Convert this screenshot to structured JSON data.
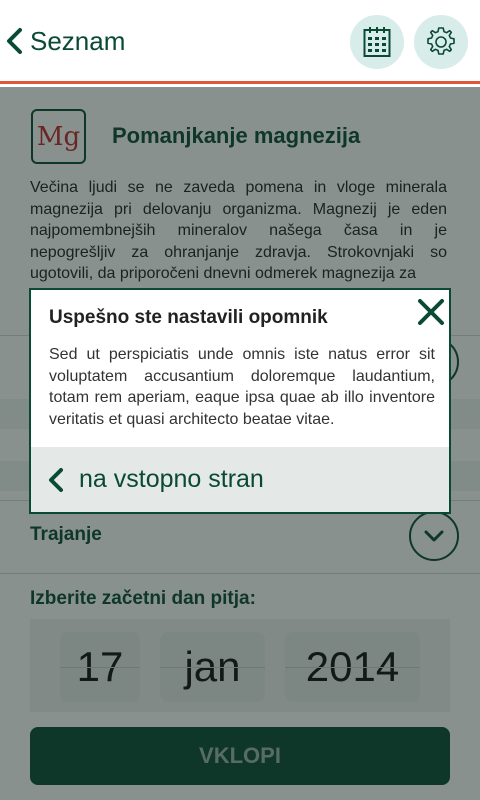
{
  "header": {
    "back_label": "Seznam",
    "calendar_icon": "calendar-icon",
    "settings_icon": "gear-icon"
  },
  "mineral": {
    "symbol": "Mg",
    "title": "Pomanjkanje magnezija",
    "intro": "Večina ljudi se ne zaveda pomena in vloge minerala magnezija pri delovanju organizma. Magnezij je eden najpomembnejših mineralov našega časa in je nepogrešljiv za ohranjanje zdravja. Strokovnjaki so ugotovili, da priporočeni dnevni odmerek magnezija za"
  },
  "duration": {
    "label": "Trajanje"
  },
  "start_date": {
    "label": "Izberite začetni dan pitja:",
    "day": "17",
    "month": "jan",
    "year": "2014"
  },
  "submit_label": "VKLOPI",
  "dialog": {
    "title": "Uspešno ste nastavili opomnik",
    "body": "Sed ut perspiciatis unde omnis iste natus error sit voluptatem accusantium doloremque laudantium, totam rem aperiam, eaque ipsa quae ab illo inventore veritatis et quasi architecto beatae vitae.",
    "action_label": "na vstopno stran"
  },
  "colors": {
    "primary": "#0a4a35",
    "accent": "#e0553a",
    "icon_bg": "#d8ecea",
    "symbol": "#c0282d"
  }
}
